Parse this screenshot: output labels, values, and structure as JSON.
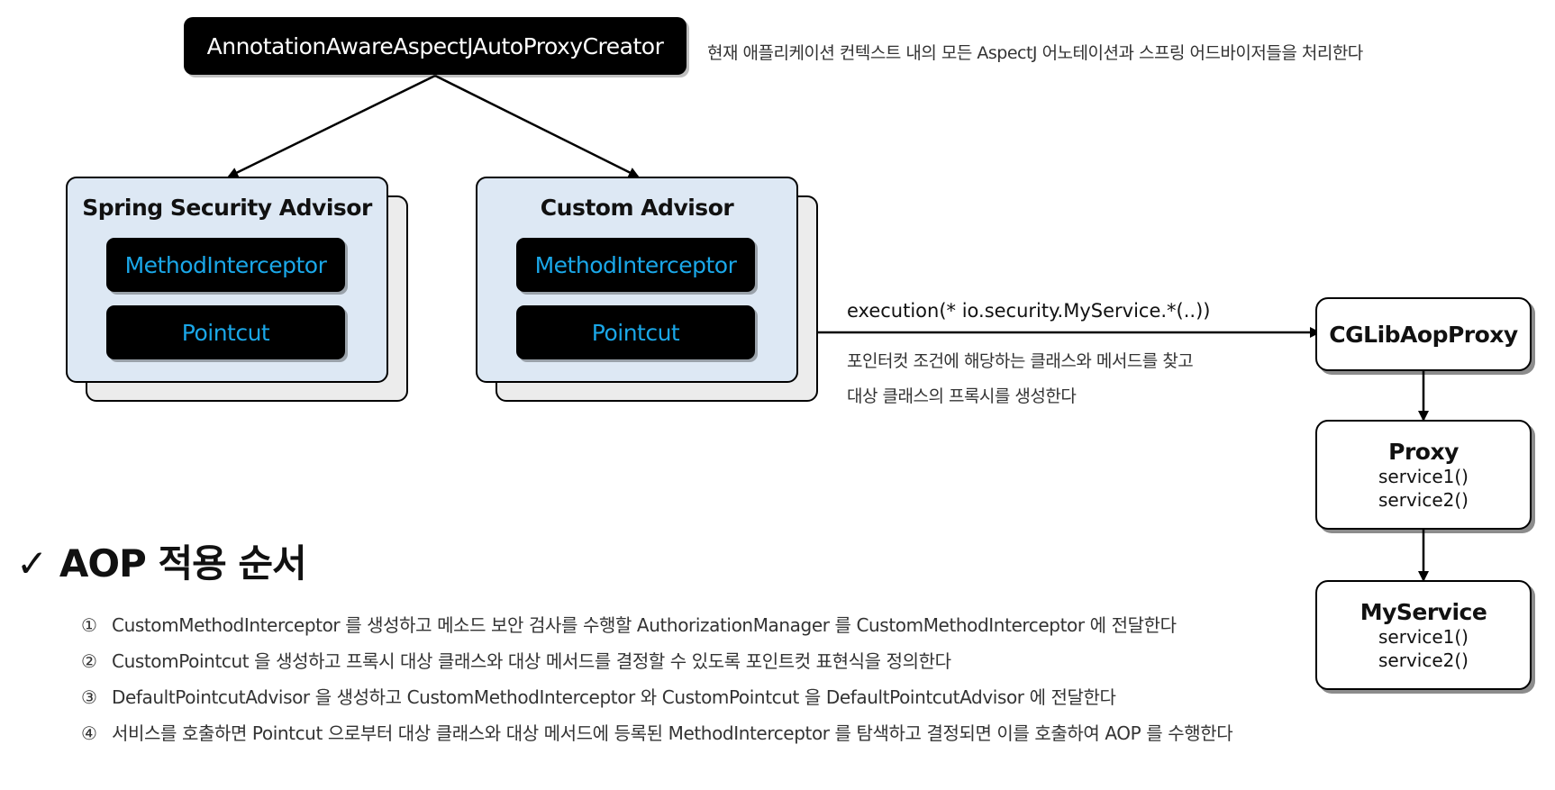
{
  "root": {
    "label": "AnnotationAwareAspectJAutoProxyCreator",
    "description": "현재 애플리케이션 컨텍스트 내의 모든 AspectJ 어노테이션과 스프링 어드바이저들을 처리한다"
  },
  "advisors": [
    {
      "title": "Spring Security Advisor",
      "interceptor": "MethodInterceptor",
      "pointcut": "Pointcut"
    },
    {
      "title": "Custom Advisor",
      "interceptor": "MethodInterceptor",
      "pointcut": "Pointcut"
    }
  ],
  "connector": {
    "expression": "execution(* io.security.MyService.*(..))",
    "note_line1": "포인터컷 조건에 해당하는 클래스와 메서드를 찾고",
    "note_line2": "대상 클래스의 프록시를 생성한다"
  },
  "proxy_chain": {
    "cglib": "CGLibAopProxy",
    "proxy": {
      "title": "Proxy",
      "methods": [
        "service1()",
        "service2()"
      ]
    },
    "service": {
      "title": "MyService",
      "methods": [
        "service1()",
        "service2()"
      ]
    }
  },
  "section": {
    "checkmark": "✓",
    "title": "AOP 적용 순서",
    "steps": [
      {
        "num": "①",
        "text": "CustomMethodInterceptor 를 생성하고 메소드 보안 검사를 수행할 AuthorizationManager 를 CustomMethodInterceptor 에 전달한다"
      },
      {
        "num": "②",
        "text": "CustomPointcut 을 생성하고 프록시 대상 클래스와 대상 메서드를 결정할 수 있도록 포인트컷 표현식을 정의한다"
      },
      {
        "num": "③",
        "text": "DefaultPointcutAdvisor 을 생성하고 CustomMethodInterceptor 와 CustomPointcut 을 DefaultPointcutAdvisor 에 전달한다"
      },
      {
        "num": "④",
        "text": "서비스를 호출하면 Pointcut 으로부터 대상 클래스와 대상 메서드에 등록된 MethodInterceptor 를 탐색하고 결정되면 이를 호출하여 AOP 를 수행한다"
      }
    ]
  },
  "colors": {
    "accent_text": "#1aa7e8",
    "card_fill": "#dde8f4",
    "shadow_fill": "#ececec"
  }
}
